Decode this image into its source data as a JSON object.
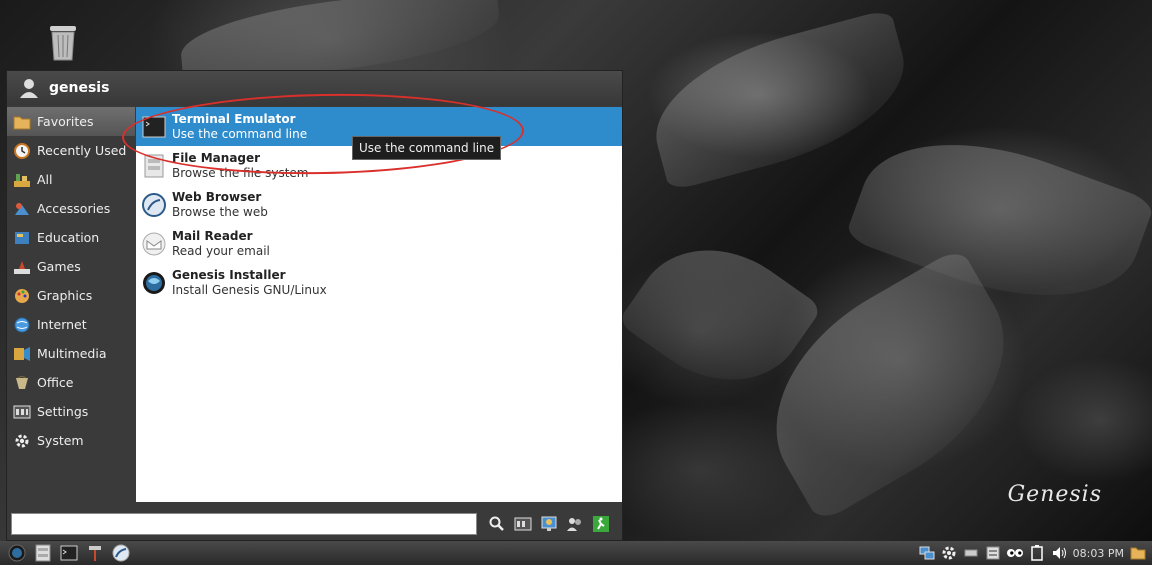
{
  "menu": {
    "user_name": "genesis",
    "categories": [
      {
        "label": "Favorites",
        "icon": "folder-icon",
        "active": true
      },
      {
        "label": "Recently Used",
        "icon": "clock-icon"
      },
      {
        "label": "All",
        "icon": "all-icon"
      },
      {
        "label": "Accessories",
        "icon": "accessories-icon"
      },
      {
        "label": "Education",
        "icon": "education-icon"
      },
      {
        "label": "Games",
        "icon": "games-icon"
      },
      {
        "label": "Graphics",
        "icon": "graphics-icon"
      },
      {
        "label": "Internet",
        "icon": "globe-icon"
      },
      {
        "label": "Multimedia",
        "icon": "multimedia-icon"
      },
      {
        "label": "Office",
        "icon": "office-icon"
      },
      {
        "label": "Settings",
        "icon": "settings-icon"
      },
      {
        "label": "System",
        "icon": "gear-icon"
      }
    ],
    "apps": [
      {
        "name": "Terminal Emulator",
        "desc": "Use the command line",
        "icon": "terminal-icon",
        "selected": true
      },
      {
        "name": "File Manager",
        "desc": "Browse the file system",
        "icon": "file-manager-icon"
      },
      {
        "name": "Web Browser",
        "desc": "Browse the web",
        "icon": "web-browser-icon"
      },
      {
        "name": "Mail Reader",
        "desc": "Read your email",
        "icon": "mail-icon"
      },
      {
        "name": "Genesis Installer",
        "desc": "Install Genesis GNU/Linux",
        "icon": "installer-icon"
      }
    ],
    "tooltip": "Use the command line",
    "search_value": ""
  },
  "desktop": {
    "logo_text": "Genesis"
  },
  "taskbar": {
    "clock": "08:03 PM"
  },
  "colors": {
    "selection": "#2f8ccc",
    "annotation": "#d9302c"
  }
}
